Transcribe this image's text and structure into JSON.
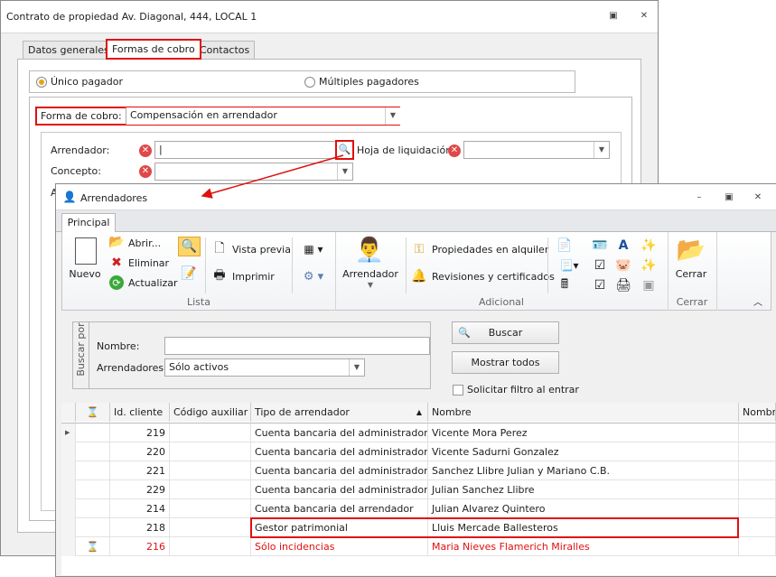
{
  "back": {
    "title": "Contrato de propiedad Av. Diagonal, 444, LOCAL 1",
    "tabs": [
      "Datos generales",
      "Formas de cobro",
      "Contactos"
    ],
    "radio_unico": "Único pagador",
    "radio_multiples": "Múltiples pagadores",
    "forma_label": "Forma de cobro:",
    "forma_value": "Compensación en arrendador",
    "arrendador_label": "Arrendador:",
    "hoja_label": "Hoja de liquidación:",
    "concepto_label": "Concepto:",
    "partial_label": "A"
  },
  "front": {
    "title": "Arrendadores",
    "ribbon_tab": "Principal",
    "lista": {
      "nuevo": "Nuevo",
      "abrir": "Abrir...",
      "eliminar": "Eliminar",
      "actualizar": "Actualizar",
      "vista_previa": "Vista previa",
      "imprimir": "Imprimir",
      "group": "Lista"
    },
    "adicional": {
      "arrendador": "Arrendador",
      "propiedades": "Propiedades en alquiler",
      "revisiones": "Revisiones y certificados",
      "group": "Adicional"
    },
    "cerrar": {
      "label": "Cerrar",
      "group": "Cerrar"
    },
    "search": {
      "legend": "Buscar por",
      "nombre_label": "Nombre:",
      "nombre_value": "",
      "arrendadores_label": "Arrendadores:",
      "arrendadores_value": "Sólo activos",
      "buscar": "Buscar",
      "mostrar": "Mostrar todos",
      "solicitar": "Solicitar filtro al entrar"
    },
    "grid": {
      "headers": [
        "Id. cliente",
        "Código auxiliar",
        "Tipo de arrendador",
        "Nombre",
        "Nombr"
      ],
      "rows": [
        {
          "id": "219",
          "cod": "",
          "tipo": "Cuenta bancaria del administrador",
          "nombre": "Vicente Mora Perez"
        },
        {
          "id": "220",
          "cod": "",
          "tipo": "Cuenta bancaria del administrador",
          "nombre": "Vicente Sadurni Gonzalez"
        },
        {
          "id": "221",
          "cod": "",
          "tipo": "Cuenta bancaria del administrador",
          "nombre": "Sanchez Llibre Julian y Mariano C.B."
        },
        {
          "id": "229",
          "cod": "",
          "tipo": "Cuenta bancaria del administrador",
          "nombre": "Julian Sanchez Llibre"
        },
        {
          "id": "214",
          "cod": "",
          "tipo": "Cuenta bancaria del arrendador",
          "nombre": "Julian Alvarez Quintero"
        },
        {
          "id": "218",
          "cod": "",
          "tipo": "Gestor patrimonial",
          "nombre": "Lluis Mercade Ballesteros"
        },
        {
          "id": "216",
          "cod": "",
          "tipo": "Sólo incidencias",
          "nombre": "Maria Nieves Flamerich Miralles"
        }
      ]
    }
  },
  "colors": {
    "highlight": "#e01010",
    "accent": "#e8a317"
  }
}
